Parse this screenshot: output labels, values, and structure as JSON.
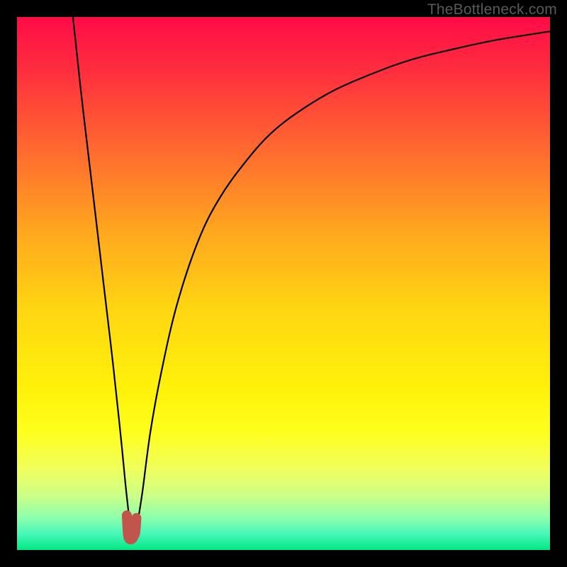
{
  "watermark": "TheBottleneck.com",
  "chart_data": {
    "type": "line",
    "title": "",
    "xlabel": "",
    "ylabel": "",
    "xlim": [
      0,
      100
    ],
    "ylim": [
      0,
      100
    ],
    "grid": false,
    "legend": false,
    "background_gradient": {
      "stops": [
        {
          "offset": 0.0,
          "color": "#ff0b47"
        },
        {
          "offset": 0.1,
          "color": "#ff2e3e"
        },
        {
          "offset": 0.25,
          "color": "#ff6a30"
        },
        {
          "offset": 0.4,
          "color": "#ffa61f"
        },
        {
          "offset": 0.55,
          "color": "#ffd612"
        },
        {
          "offset": 0.7,
          "color": "#fff20a"
        },
        {
          "offset": 0.78,
          "color": "#feff1e"
        },
        {
          "offset": 0.85,
          "color": "#f0ff5e"
        },
        {
          "offset": 0.9,
          "color": "#c9ff8a"
        },
        {
          "offset": 0.94,
          "color": "#8cffac"
        },
        {
          "offset": 0.97,
          "color": "#47f7b7"
        },
        {
          "offset": 1.0,
          "color": "#00e884"
        }
      ]
    },
    "series": [
      {
        "name": "black-curve",
        "color": "#000000",
        "x": [
          10.5,
          12,
          14,
          16,
          18,
          19.5,
          20.6,
          21.4,
          22.3,
          23.4,
          25,
          27,
          30,
          34,
          38,
          43,
          48,
          54,
          60,
          67,
          74,
          82,
          90,
          100
        ],
        "y": [
          100,
          86,
          69,
          52,
          35,
          21,
          10,
          4.2,
          4.2,
          10,
          22,
          33,
          46,
          58,
          66,
          73,
          78.5,
          83,
          86.5,
          89.5,
          92,
          94,
          95.7,
          97.3
        ]
      },
      {
        "name": "red-dip-marker",
        "color": "#c1554e",
        "x": [
          20.6,
          20.8,
          21.0,
          21.3,
          21.6,
          21.9,
          22.2,
          22.4
        ],
        "y": [
          6.5,
          3.1,
          2.2,
          2.0,
          2.1,
          2.6,
          3.4,
          6.0
        ]
      }
    ],
    "annotations": []
  }
}
